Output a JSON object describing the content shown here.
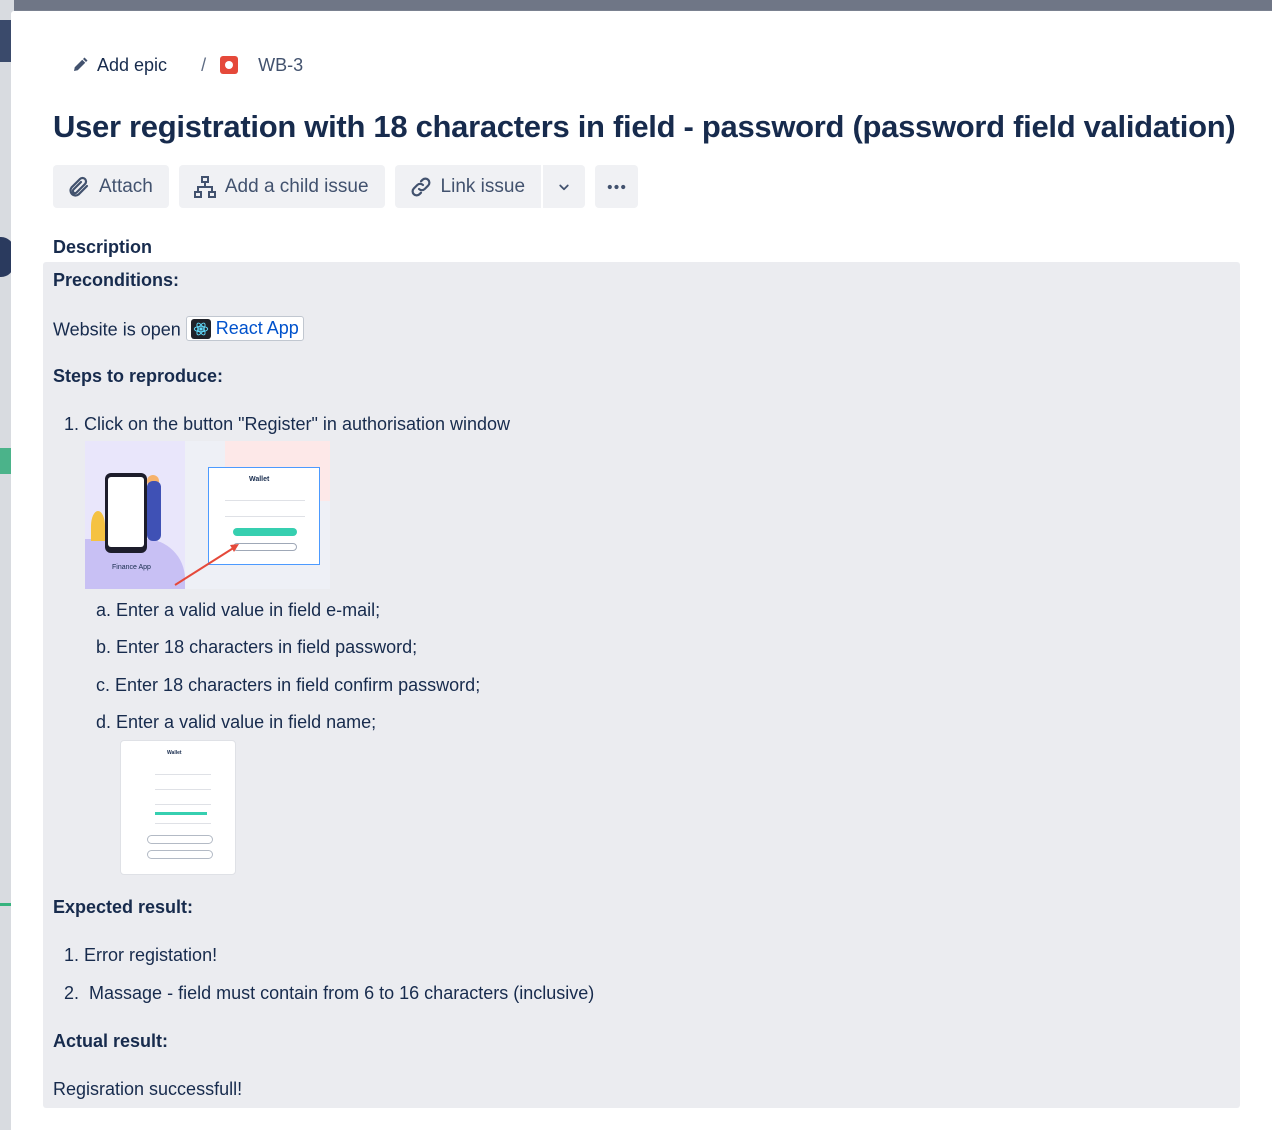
{
  "breadcrumbs": {
    "epic_label": "Add epic",
    "separator": "/",
    "issue_key": "WB-3"
  },
  "issue": {
    "title": "User registration with 18 characters in field - password (password field validation)"
  },
  "toolbar": {
    "attach": "Attach",
    "add_child": "Add a child issue",
    "link_issue": "Link issue"
  },
  "description": {
    "label": "Description",
    "preconditions_heading": "Preconditions:",
    "preconditions_text": "Website is open",
    "link_text": "React App",
    "steps_heading": "Steps to reproduce:",
    "steps": [
      {
        "num": "1.",
        "text": "Click on the button \"Register\" in authorisation window"
      }
    ],
    "substeps": [
      {
        "letter": "a.",
        "text": "Enter a valid value in  field e-mail;"
      },
      {
        "letter": "b.",
        "text": "Enter 18 characters in field password;"
      },
      {
        "letter": "c.",
        "text": "Enter 18 characters in field confirm password;"
      },
      {
        "letter": "d.",
        "text": "Enter a valid value in  field name;"
      }
    ],
    "screenshot1": {
      "caption": "Finance App",
      "card_title": "Wallet"
    },
    "screenshot2": {
      "card_title": "Wallet"
    },
    "expected_heading": "Expected result:",
    "expected": [
      {
        "num": "1.",
        "text": "Error registation!"
      },
      {
        "num": "2.",
        "text": " Massage - field must contain from 6 to 16 characters (inclusive)"
      }
    ],
    "actual_heading": "Actual result:",
    "actual_text": "Regisration successfull!"
  },
  "colors": {
    "title": "#172b4d",
    "link": "#0052cc",
    "bug": "#e5493a",
    "description_bg": "#ebecf0"
  },
  "icons": [
    "pencil-icon",
    "bug-icon",
    "attach-icon",
    "child-issue-icon",
    "link-icon",
    "chevron-down-icon",
    "more-icon",
    "react-icon"
  ]
}
